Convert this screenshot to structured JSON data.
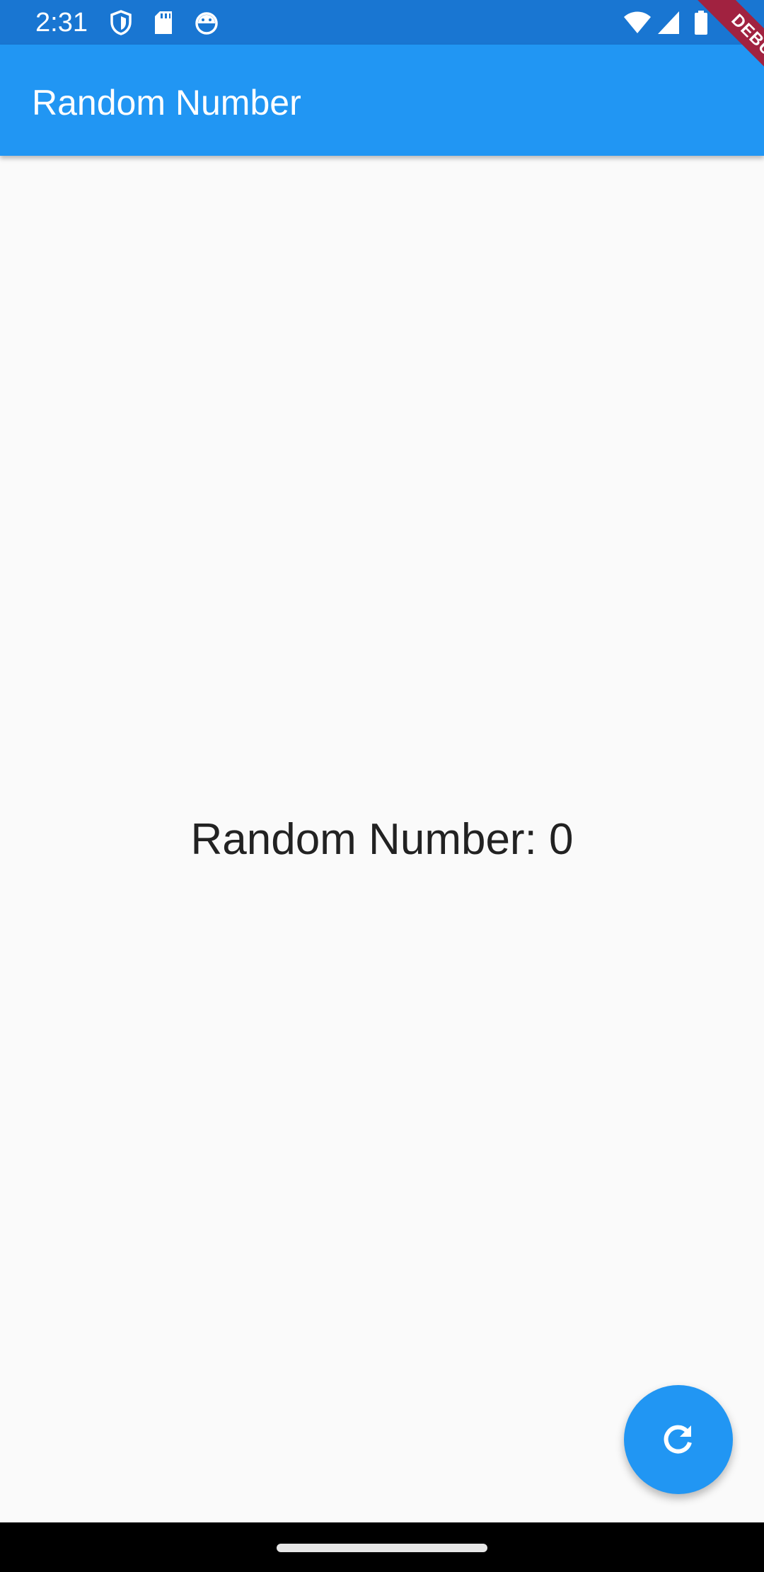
{
  "status_bar": {
    "time": "2:31",
    "left_icons": [
      "shield-icon",
      "sd-card-icon",
      "android-robot-icon"
    ],
    "right_icons": [
      "wifi-icon",
      "cellular-signal-icon",
      "battery-icon"
    ]
  },
  "app_bar": {
    "title": "Random Number",
    "color": "#2196f3"
  },
  "debug_banner": {
    "label": "DEBUG",
    "color": "#a12240"
  },
  "main": {
    "random_text": "Random Number: 0"
  },
  "fab": {
    "icon": "refresh-icon",
    "color": "#2196f3"
  }
}
